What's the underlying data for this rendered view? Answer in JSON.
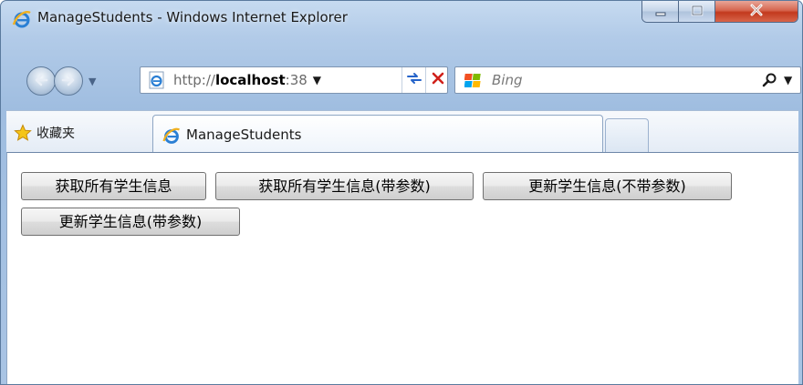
{
  "window": {
    "title": "ManageStudents - Windows Internet Explorer"
  },
  "nav": {
    "address_prefix": "http://",
    "address_host": "localhost",
    "address_suffix": ":38",
    "search_placeholder": "Bing"
  },
  "favorites": {
    "label": "收藏夹"
  },
  "tabs": [
    {
      "label": "ManageStudents"
    }
  ],
  "buttons": {
    "get_all": "获取所有学生信息",
    "get_all_params": "获取所有学生信息(带参数)",
    "update_no_params": "更新学生信息(不带参数)",
    "update_params": "更新学生信息(带参数)"
  },
  "colors": {
    "window_frame": "#b2cbe8",
    "close_button": "#c2391d",
    "refresh": "#2563c9",
    "stop": "#d0201a"
  }
}
